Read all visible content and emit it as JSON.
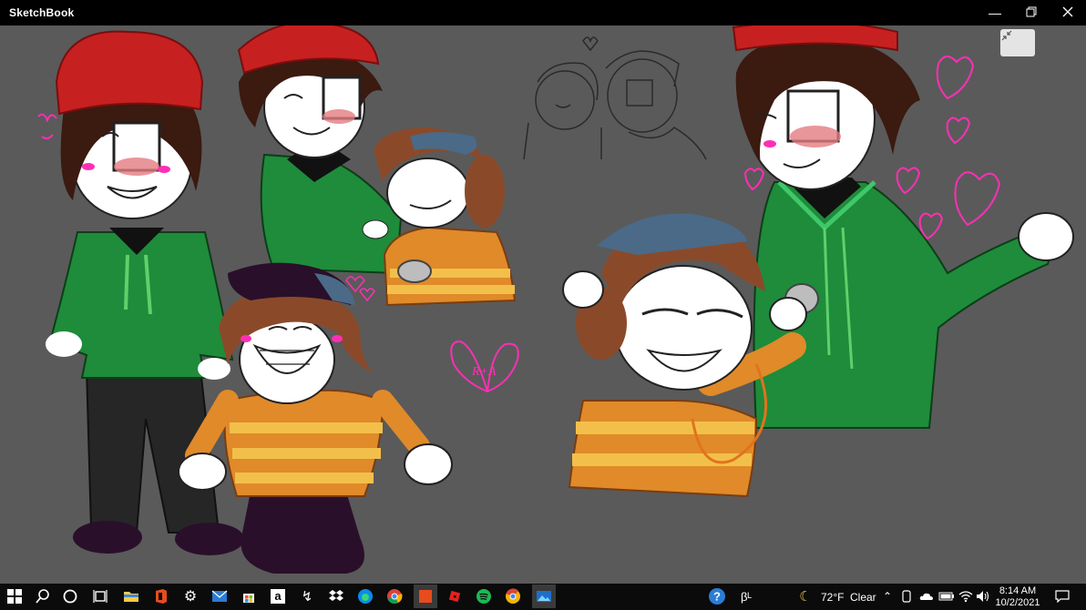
{
  "window": {
    "title": "SketchBook",
    "controls": [
      "minimize-icon",
      "restore-icon",
      "close-icon"
    ]
  },
  "canvas": {
    "background": "#5a5a5a",
    "restore_button_icon": "shrink-arrows-icon",
    "artwork_heart_text": "R+A"
  },
  "taskbar": {
    "pinned_icons": [
      "windows-start-icon",
      "search-icon",
      "cortana-icon",
      "task-view-icon",
      "file-explorer-icon",
      "office-icon",
      "settings-icon",
      "mail-icon",
      "store-icon",
      "amazon-icon",
      "lightning-icon",
      "dropbox-icon",
      "edge-icon",
      "chrome-icon",
      "app-orange-icon",
      "roblox-icon",
      "spotify-icon",
      "chrome-icon-2",
      "photos-icon"
    ],
    "tray": {
      "weather_icon": "moon-icon",
      "temperature": "72°F",
      "condition": "Clear",
      "icons": [
        "chevron-up-icon",
        "meet-now-icon",
        "onedrive-icon",
        "battery-icon",
        "wifi-icon",
        "volume-icon"
      ]
    },
    "clock": {
      "time": "8:14 AM",
      "date": "10/2/2021"
    },
    "notification_icon": "notification-icon"
  },
  "colors": {
    "hat_red": "#c72020",
    "hoodie_green": "#1e8c3a",
    "sweater_orange": "#e08a2a",
    "sweater_yellow": "#f2c04a",
    "hair_brown": "#3b1a10",
    "cap_blue": "#4a6a88",
    "heart_pink": "#ff2fb5"
  }
}
